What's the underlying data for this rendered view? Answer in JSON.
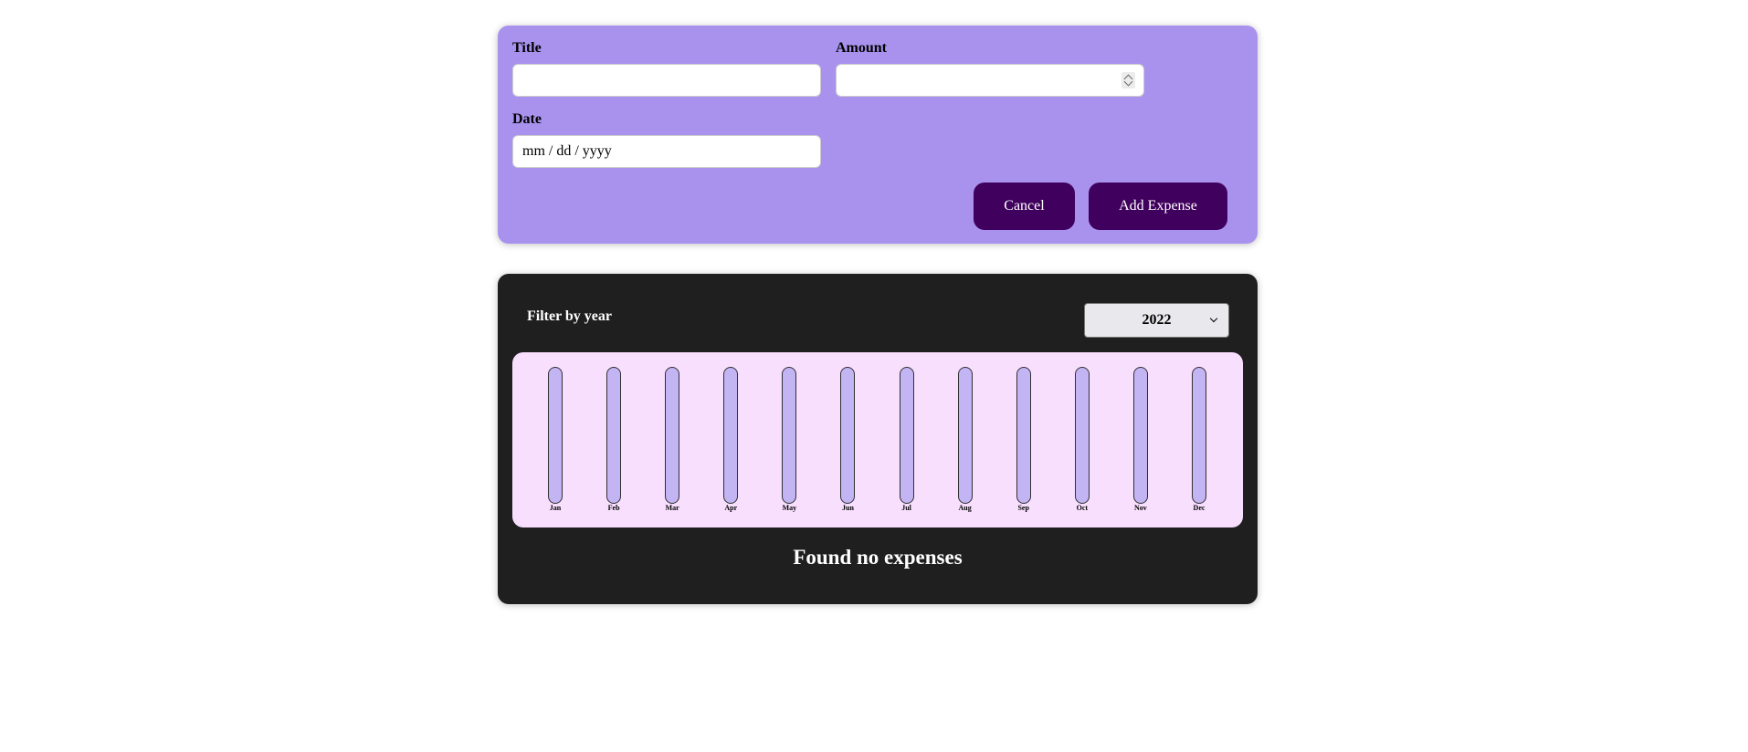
{
  "form": {
    "title_label": "Title",
    "title_value": "",
    "amount_label": "Amount",
    "amount_value": "",
    "date_label": "Date",
    "date_placeholder": "mm / dd / yyyy",
    "cancel_label": "Cancel",
    "submit_label": "Add Expense"
  },
  "filter": {
    "label": "Filter by year",
    "selected_year": "2022"
  },
  "chart_data": {
    "type": "bar",
    "categories": [
      "Jan",
      "Feb",
      "Mar",
      "Apr",
      "May",
      "Jun",
      "Jul",
      "Aug",
      "Sep",
      "Oct",
      "Nov",
      "Dec"
    ],
    "values": [
      0,
      0,
      0,
      0,
      0,
      0,
      0,
      0,
      0,
      0,
      0,
      0
    ]
  },
  "list": {
    "empty_message": "Found no expenses"
  },
  "colors": {
    "form_background": "#a892ee",
    "button_background": "#40005d",
    "panel_background": "#1f1f1f",
    "chart_background": "#f8dffe",
    "bar_track": "#c3b4f3",
    "bar_fill": "#4826b9"
  }
}
